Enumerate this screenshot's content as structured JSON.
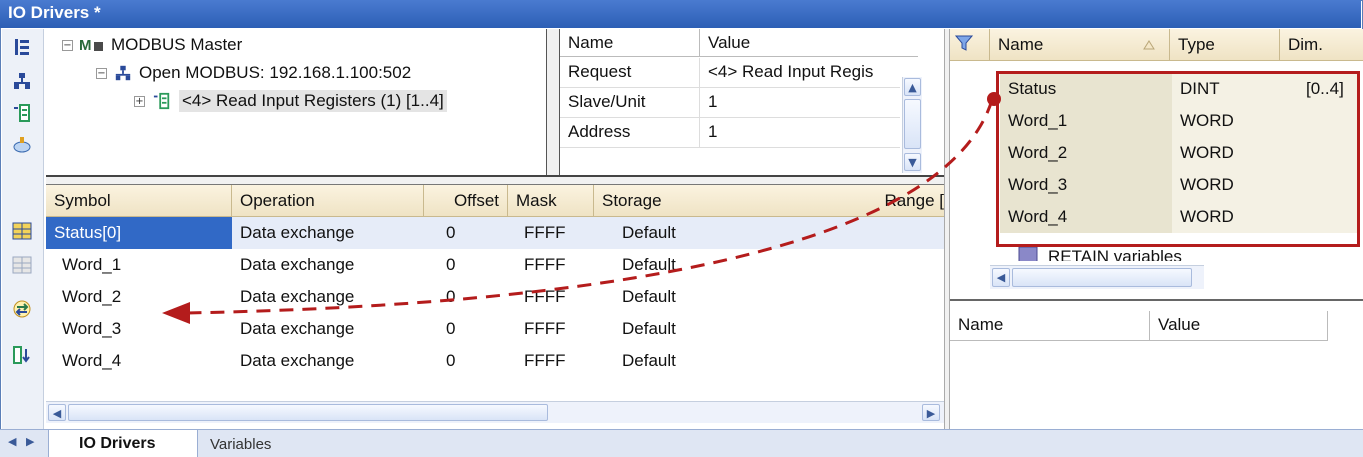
{
  "window": {
    "title": "IO Drivers *"
  },
  "left_toolbar": {
    "icons": [
      "tree-view-icon",
      "network-icon",
      "register-icon",
      "driver-plug-icon",
      "table-icon",
      "table-disabled-icon",
      "swap-icon",
      "insert-below-icon"
    ]
  },
  "tree": {
    "items": [
      {
        "label": "MODBUS Master",
        "expander": "−",
        "icon": "modbus-master-icon"
      },
      {
        "label": "Open MODBUS: 192.168.1.100:502",
        "expander": "−",
        "icon": "network-icon"
      },
      {
        "label": "<4> Read Input Registers (1) [1..4]",
        "expander": "+",
        "icon": "register-icon"
      }
    ]
  },
  "properties": {
    "headers": {
      "name": "Name",
      "value": "Value"
    },
    "rows": [
      {
        "name": "Request",
        "value": "<4> Read Input Regis"
      },
      {
        "name": "Slave/Unit",
        "value": "1"
      },
      {
        "name": "Address",
        "value": "1"
      }
    ]
  },
  "grid": {
    "headers": {
      "symbol": "Symbol",
      "operation": "Operation",
      "offset": "Offset",
      "mask": "Mask",
      "storage": "Storage",
      "range": "Range ["
    },
    "rows": [
      {
        "symbol": "Status[0]",
        "operation": "Data exchange",
        "offset": "0",
        "mask": "FFFF",
        "storage": "Default"
      },
      {
        "symbol": "Word_1",
        "operation": "Data exchange",
        "offset": "0",
        "mask": "FFFF",
        "storage": "Default"
      },
      {
        "symbol": "Word_2",
        "operation": "Data exchange",
        "offset": "0",
        "mask": "FFFF",
        "storage": "Default"
      },
      {
        "symbol": "Word_3",
        "operation": "Data exchange",
        "offset": "0",
        "mask": "FFFF",
        "storage": "Default"
      },
      {
        "symbol": "Word_4",
        "operation": "Data exchange",
        "offset": "0",
        "mask": "FFFF",
        "storage": "Default"
      }
    ]
  },
  "variables": {
    "headers": {
      "name": "Name",
      "type": "Type",
      "dim": "Dim."
    },
    "rows": [
      {
        "name": "Status",
        "type": "DINT",
        "dim": "[0..4]"
      },
      {
        "name": "Word_1",
        "type": "WORD",
        "dim": ""
      },
      {
        "name": "Word_2",
        "type": "WORD",
        "dim": ""
      },
      {
        "name": "Word_3",
        "type": "WORD",
        "dim": ""
      },
      {
        "name": "Word_4",
        "type": "WORD",
        "dim": ""
      }
    ],
    "group_label": "RETAIN variables"
  },
  "value_panel": {
    "name_header": "Name",
    "value_header": "Value"
  },
  "tabs": [
    {
      "label": "IO Drivers",
      "active": true
    },
    {
      "label": "Variables",
      "active": false
    }
  ],
  "colors": {
    "selection": "#3169c6",
    "annotation": "#b41c1c",
    "header": "#efe3c4"
  }
}
